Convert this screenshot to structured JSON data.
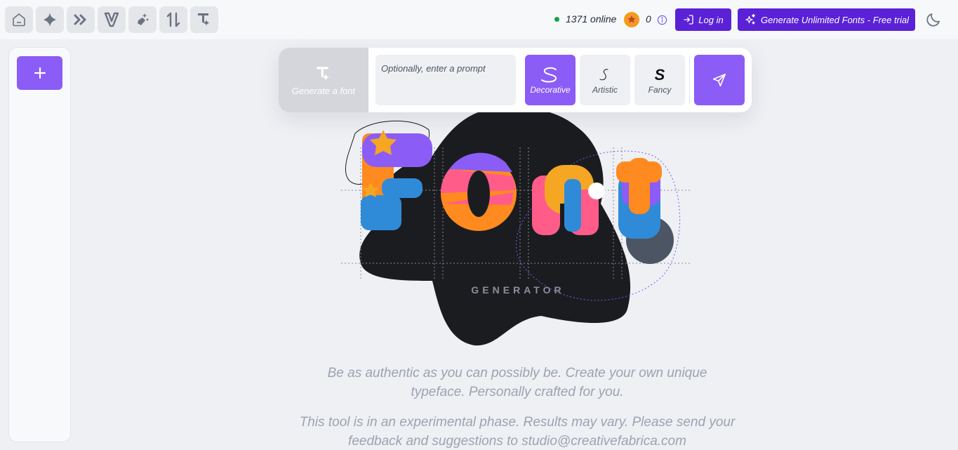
{
  "nav": {
    "icons": [
      "home-icon",
      "sparkle-icon",
      "chevrons-icon",
      "v-logo-icon",
      "magic-wand-icon",
      "sort-icon",
      "text-sparkle-icon"
    ]
  },
  "header": {
    "online_count": "1371 online",
    "coin_count": "0",
    "login_label": "Log in",
    "trial_label": "Generate Unlimited Fonts - Free trial"
  },
  "sidebar": {
    "new_button_icon": "plus-icon"
  },
  "generator": {
    "tab_label": "Generate a font",
    "prompt_placeholder": "Optionally, enter a prompt",
    "prompt_value": "",
    "styles": [
      {
        "label": "Decorative",
        "glyph": "S",
        "selected": true
      },
      {
        "label": "Artistic",
        "glyph": "S",
        "selected": false
      },
      {
        "label": "Fancy",
        "glyph": "S",
        "selected": false
      }
    ],
    "send_icon": "send-icon"
  },
  "hero": {
    "word": "Font",
    "subtitle": "GENERATOR"
  },
  "content": {
    "tagline": "Be as authentic as you can possibly be. Create your own unique typeface. Personally crafted for you.",
    "disclaimer": "This tool is in an experimental phase. Results may vary. Please send your feedback and suggestions to studio@creativefabrica.com"
  },
  "colors": {
    "accent": "#8b5cf6",
    "button_dark": "#5b21d6",
    "online": "#10a34a",
    "background": "#eef0f4"
  }
}
